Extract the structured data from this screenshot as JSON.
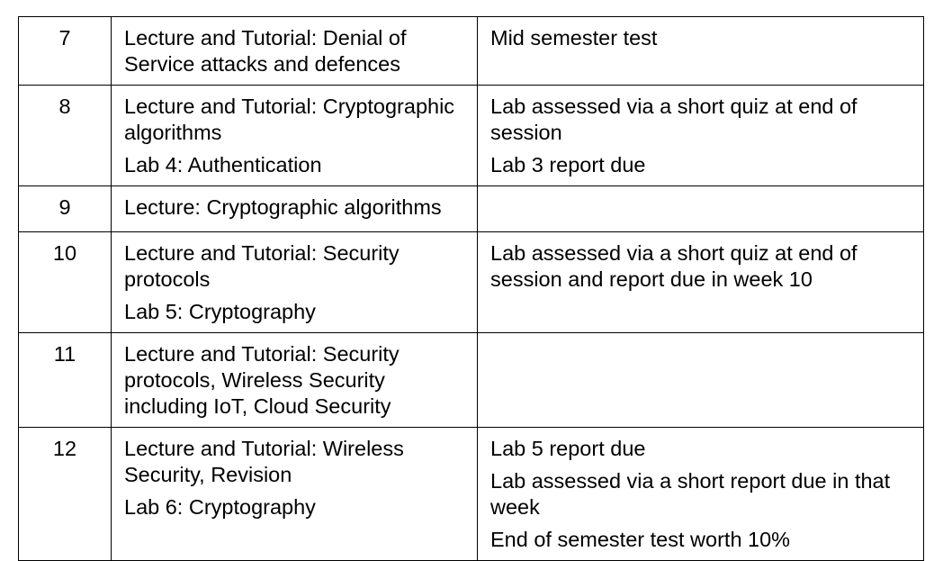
{
  "rows": [
    {
      "week": "7",
      "activities": [
        "Lecture and Tutorial: Denial of Service attacks and defences"
      ],
      "assessment": [
        "Mid semester test"
      ]
    },
    {
      "week": "8",
      "activities": [
        "Lecture and Tutorial: Cryptographic algorithms",
        "Lab 4: Authentication"
      ],
      "assessment": [
        "Lab assessed via a short quiz at end of session",
        "Lab 3 report due"
      ]
    },
    {
      "week": "9",
      "activities": [
        "Lecture: Cryptographic algorithms"
      ],
      "assessment": []
    },
    {
      "week": "10",
      "activities": [
        "Lecture and Tutorial: Security protocols",
        "Lab 5: Cryptography"
      ],
      "assessment": [
        "Lab assessed via a short quiz at end of session and report due in week 10"
      ]
    },
    {
      "week": "11",
      "activities": [
        "Lecture and Tutorial: Security protocols, Wireless Security including IoT, Cloud Security"
      ],
      "assessment": []
    },
    {
      "week": "12",
      "activities": [
        "Lecture and Tutorial: Wireless Security, Revision",
        "Lab 6: Cryptography"
      ],
      "assessment": [
        "Lab 5 report due",
        "Lab assessed via a short report due in that week",
        "End of semester test worth 10%"
      ]
    }
  ]
}
